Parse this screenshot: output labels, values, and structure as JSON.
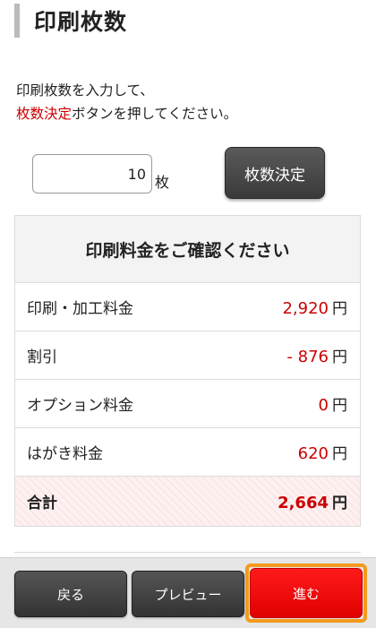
{
  "header": {
    "title": "印刷枚数"
  },
  "instructions": {
    "line1": "印刷枚数を入力して、",
    "line2_highlight": "枚数決定",
    "line2_rest": "ボタンを押してください。"
  },
  "quantity": {
    "value": "10",
    "unit": "枚",
    "decide_label": "枚数決定"
  },
  "price": {
    "header": "印刷料金をご確認ください",
    "rows": [
      {
        "label": "印刷・加工料金",
        "value": "2,920",
        "unit": "円"
      },
      {
        "label": "割引",
        "value": "- 876",
        "unit": "円"
      },
      {
        "label": "オプション料金",
        "value": "0",
        "unit": "円"
      },
      {
        "label": "はがき料金",
        "value": "620",
        "unit": "円"
      }
    ],
    "total": {
      "label": "合計",
      "value": "2,664",
      "unit": "円"
    }
  },
  "footer": {
    "back_label": "戻る",
    "preview_label": "プレビュー",
    "next_label": "進む"
  },
  "colors": {
    "accent_red": "#cc0000",
    "next_button": "#ff0000",
    "next_highlight": "#f39a1e",
    "dark_button": "#444444"
  }
}
